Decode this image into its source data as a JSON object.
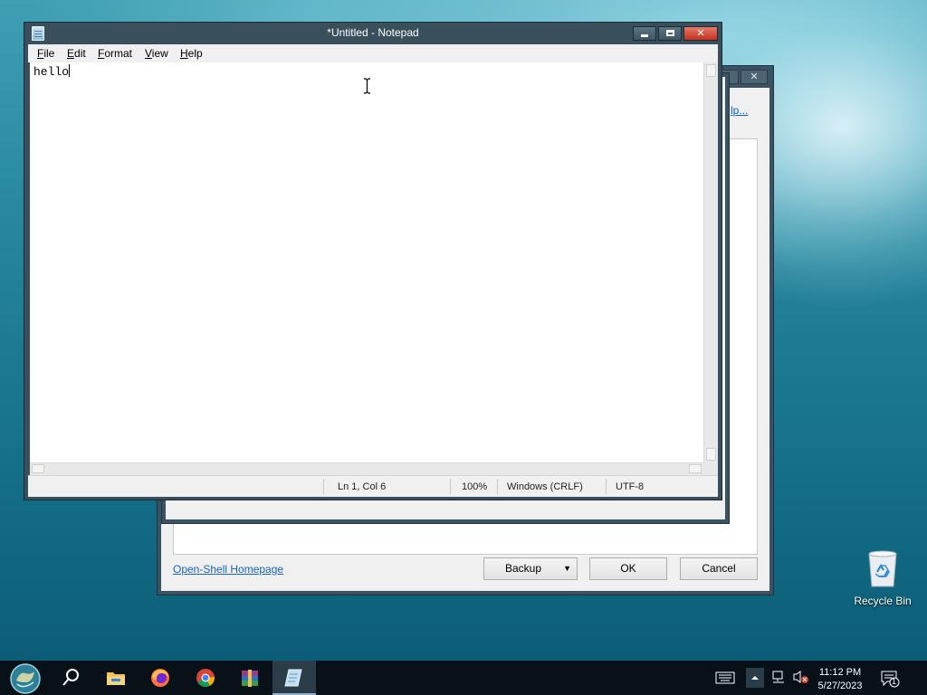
{
  "notepad": {
    "title": "*Untitled - Notepad",
    "menu": [
      {
        "mnemonic": "F",
        "rest": "ile"
      },
      {
        "mnemonic": "E",
        "rest": "dit"
      },
      {
        "mnemonic": "F",
        "rest": "ormat"
      },
      {
        "mnemonic": "V",
        "rest": "iew"
      },
      {
        "mnemonic": "H",
        "rest": "elp"
      }
    ],
    "content": "hello",
    "status": {
      "position": "Ln 1, Col 6",
      "zoom": "100%",
      "line_ending": "Windows (CRLF)",
      "encoding": "UTF-8"
    }
  },
  "background_dialog": {
    "help_link": "lp...",
    "homepage_link": "Open-Shell Homepage",
    "backup_label": "Backup",
    "ok_label": "OK",
    "cancel_label": "Cancel"
  },
  "desktop": {
    "recycle_bin_label": "Recycle Bin"
  },
  "taskbar": {
    "time": "11:12 PM",
    "date": "5/27/2023",
    "notification_count": "1",
    "apps": [
      "start-orb-icon",
      "search-icon",
      "file-explorer-icon",
      "firefox-icon",
      "chrome-icon",
      "winrar-icon",
      "notepad-icon"
    ]
  }
}
